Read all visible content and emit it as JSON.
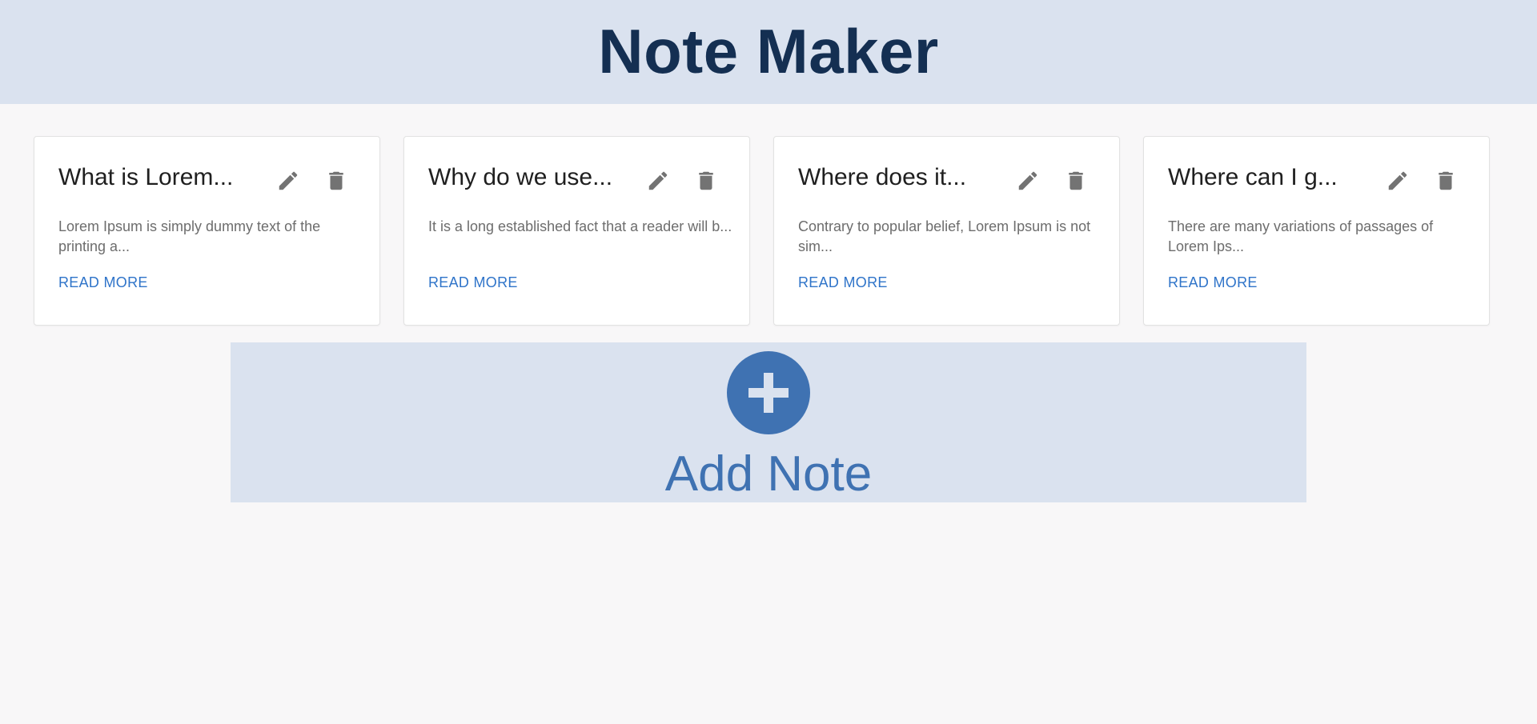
{
  "header": {
    "title": "Note Maker"
  },
  "notes": [
    {
      "title": "What is Lorem...",
      "excerpt": "Lorem Ipsum is simply dummy text of the printing a...",
      "read_more": "READ MORE"
    },
    {
      "title": "Why do we use...",
      "excerpt": "It is a long established fact that a reader will b...",
      "read_more": "READ MORE"
    },
    {
      "title": "Where does it...",
      "excerpt": "Contrary to popular belief, Lorem Ipsum is not sim...",
      "read_more": "READ MORE"
    },
    {
      "title": "Where can I g...",
      "excerpt": "There are many variations of passages of Lorem Ips...",
      "read_more": "READ MORE"
    }
  ],
  "add_note": {
    "label": "Add Note",
    "icon": "plus-icon"
  },
  "icons": {
    "edit": "pencil-icon",
    "delete": "trash-icon"
  },
  "colors": {
    "header_bg": "#dae2ef",
    "title": "#142f52",
    "accent": "#3f72b2",
    "link": "#2f74c9",
    "icon": "#737373",
    "page_bg": "#f8f7f8"
  }
}
